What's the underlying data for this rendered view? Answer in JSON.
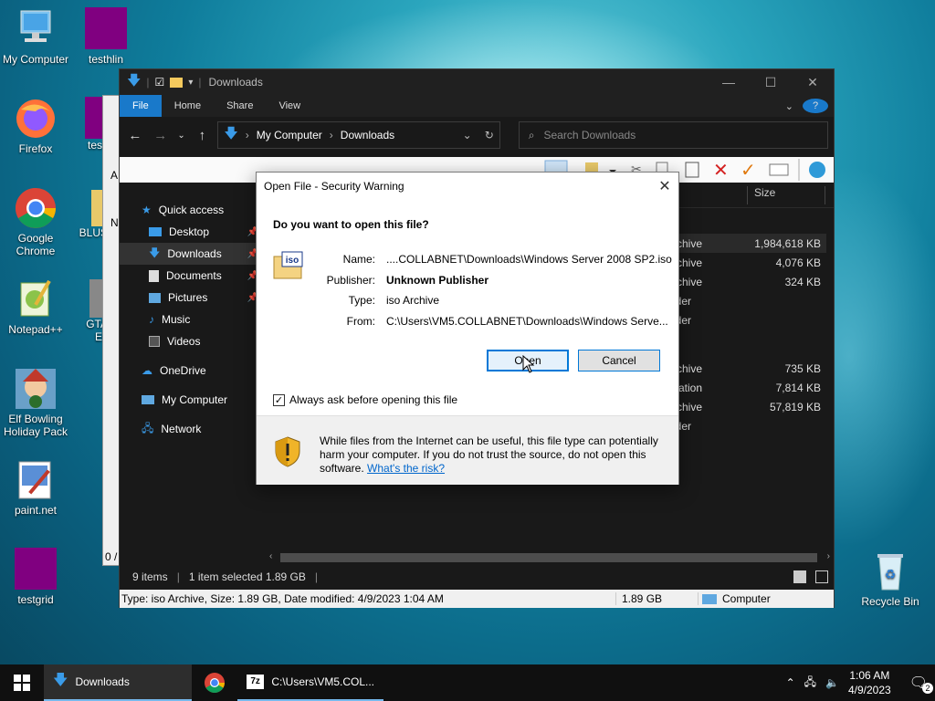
{
  "desktop": {
    "icons": [
      {
        "label": "My Computer"
      },
      {
        "label": "testhlin"
      },
      {
        "label": "Firefox"
      },
      {
        "label": "Google Chrome"
      },
      {
        "label": "Notepad++"
      },
      {
        "label": "Elf Bowling Holiday Pack"
      },
      {
        "label": "paint.net"
      },
      {
        "label": "testgrid"
      },
      {
        "label": "Recycle Bin"
      },
      {
        "label": "BLUS"
      },
      {
        "label": "GTA"
      },
      {
        "label": "Ec"
      },
      {
        "label": "tes"
      }
    ]
  },
  "explorer": {
    "title": "Downloads",
    "ribbon_tabs": [
      "File",
      "Home",
      "Share",
      "View"
    ],
    "breadcrumb": [
      "My Computer",
      "Downloads"
    ],
    "search_placeholder": "Search Downloads",
    "column_size": "Size",
    "sidebar": [
      {
        "label": "Quick access"
      },
      {
        "label": "Desktop"
      },
      {
        "label": "Downloads"
      },
      {
        "label": "Documents"
      },
      {
        "label": "Pictures"
      },
      {
        "label": "Music"
      },
      {
        "label": "Videos"
      },
      {
        "label": "OneDrive"
      },
      {
        "label": "My Computer"
      },
      {
        "label": "Network"
      }
    ],
    "rows": [
      {
        "type": "rchive",
        "size": "1,984,618 KB"
      },
      {
        "type": "rchive",
        "size": "4,076 KB"
      },
      {
        "type": "rchive",
        "size": "324 KB"
      },
      {
        "type": "lder",
        "size": ""
      },
      {
        "type": "lder",
        "size": ""
      },
      {
        "type": "rchive",
        "size": "735 KB"
      },
      {
        "type": "cation",
        "size": "7,814 KB"
      },
      {
        "type": "rchive",
        "size": "57,819 KB"
      },
      {
        "type": "lder",
        "size": ""
      }
    ],
    "status": {
      "items": "9 items",
      "selected": "1 item selected  1.89 GB"
    },
    "bottom": {
      "details": "Type: iso Archive, Size: 1.89 GB, Date modified: 4/9/2023 1:04 AM",
      "size": "1.89 GB",
      "location": "Computer"
    }
  },
  "behind_window": {
    "text_fragments": [
      "N",
      "A",
      "0 /"
    ]
  },
  "dialog": {
    "title": "Open File - Security Warning",
    "question": "Do you want to open this file?",
    "name_label": "Name:",
    "name_value": "....COLLABNET\\Downloads\\Windows Server 2008 SP2.iso",
    "publisher_label": "Publisher:",
    "publisher_value": "Unknown Publisher",
    "type_label": "Type:",
    "type_value": "iso Archive",
    "from_label": "From:",
    "from_value": "C:\\Users\\VM5.COLLABNET\\Downloads\\Windows Serve...",
    "open_button": "Open",
    "cancel_button": "Cancel",
    "checkbox_label": "Always ask before opening this file",
    "checkbox_checked": true,
    "warning_text": "While files from the Internet can be useful, this file type can potentially harm your computer. If you do not trust the source, do not open this software. ",
    "risk_link": "What's the risk?",
    "iso_icon_text": "iso"
  },
  "taskbar": {
    "items": [
      {
        "label": "Downloads"
      },
      {
        "label": ""
      },
      {
        "label": "C:\\Users\\VM5.COL..."
      }
    ],
    "time": "1:06 AM",
    "date": "4/9/2023",
    "notification_count": "2"
  }
}
